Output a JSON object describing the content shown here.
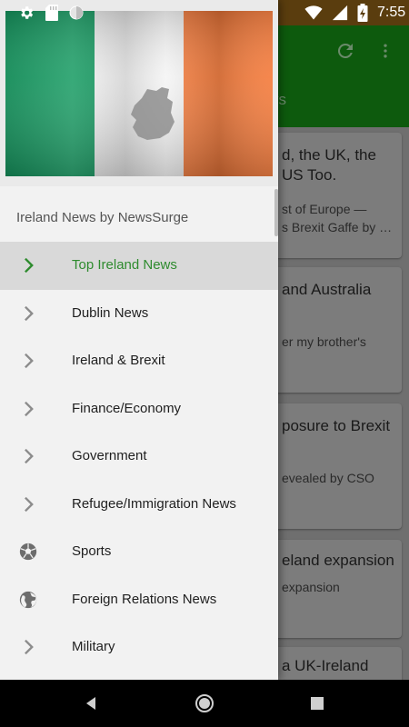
{
  "status_bar": {
    "time": "7:55",
    "left_icons": [
      "gear-icon",
      "sd-card-icon",
      "circle-icon"
    ],
    "right_icons": [
      "wifi-icon",
      "signal-icon",
      "battery-charging-icon"
    ]
  },
  "background_app": {
    "tab_partial": "vs",
    "toolbar_icons": [
      "refresh-icon",
      "more-vert-icon"
    ],
    "cards": [
      {
        "title": "d, the UK, the\nUS Too.",
        "snippet": "st of Europe —\ns Brexit Gaffe by …"
      },
      {
        "title": "and Australia",
        "snippet": "er my brother's"
      },
      {
        "title": "posure to Brexit",
        "snippet": "evealed by CSO"
      },
      {
        "title": "eland expansion",
        "snippet": "expansion"
      },
      {
        "title": "a UK-Ireland",
        "snippet": ""
      }
    ]
  },
  "drawer": {
    "header_image": "ireland-flag-image",
    "subtitle": "Ireland News by NewsSurge",
    "items": [
      {
        "label": "Top Ireland News",
        "icon": "chevron-right-icon",
        "active": true
      },
      {
        "label": "Dublin News",
        "icon": "chevron-right-icon"
      },
      {
        "label": "Ireland & Brexit",
        "icon": "chevron-right-icon"
      },
      {
        "label": "Finance/Economy",
        "icon": "chevron-right-icon"
      },
      {
        "label": "Government",
        "icon": "chevron-right-icon"
      },
      {
        "label": "Refugee/Immigration News",
        "icon": "chevron-right-icon"
      },
      {
        "label": "Sports",
        "icon": "soccer-ball-icon"
      },
      {
        "label": "Foreign Relations News",
        "icon": "globe-icon"
      },
      {
        "label": "Military",
        "icon": "chevron-right-icon"
      }
    ]
  },
  "colors": {
    "accent": "#2e8b2e",
    "toolbar": "#1b7a1b",
    "flag_green": "#169b62",
    "flag_white": "#ffffff",
    "flag_orange": "#ff883e"
  },
  "nav_bar": {
    "buttons": [
      "back-icon",
      "home-icon",
      "recents-icon"
    ]
  }
}
